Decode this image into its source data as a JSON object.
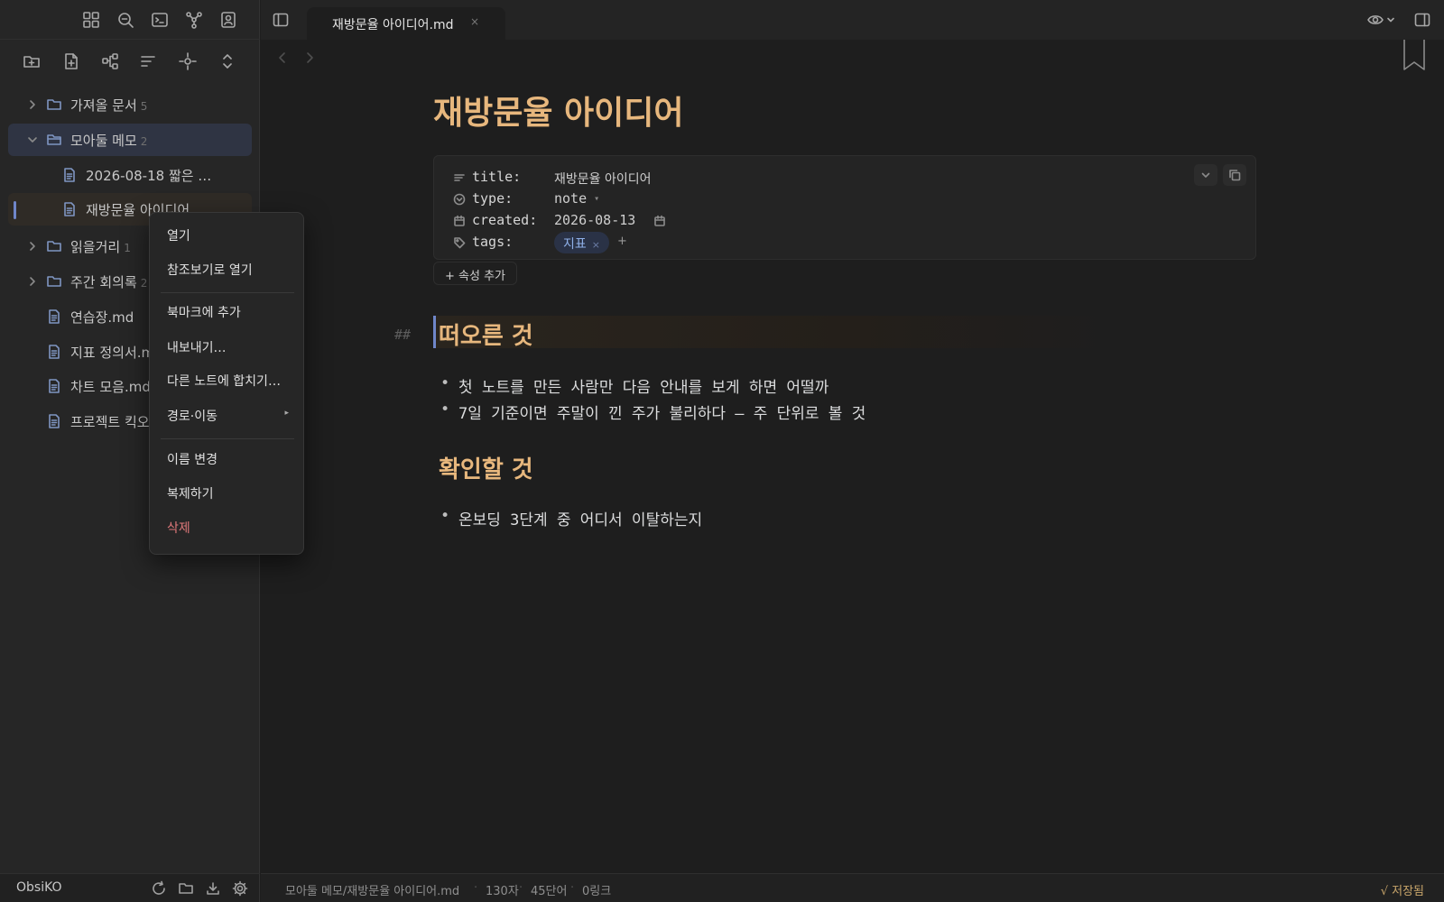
{
  "app": {
    "vault_name": "ObsiKO"
  },
  "tab": {
    "title": "재방문율 아이디어.md",
    "close": "×"
  },
  "tree": {
    "items": [
      {
        "label": "가져올 문서",
        "count": "5"
      },
      {
        "label": "모아둘 메모",
        "count": "2"
      },
      {
        "label": "2026-08-18 짧은 …"
      },
      {
        "label": "재방문율 아이디어"
      },
      {
        "label": "읽을거리",
        "count": "1"
      },
      {
        "label": "주간 회의록",
        "count": "2"
      },
      {
        "label": "연습장.md"
      },
      {
        "label": "지표 정의서.md"
      },
      {
        "label": "차트 모음.md"
      },
      {
        "label": "프로젝트 킥오프"
      }
    ]
  },
  "context_menu": {
    "items": [
      {
        "label": "열기"
      },
      {
        "label": "참조보기로 열기"
      },
      {
        "label": "북마크에 추가"
      },
      {
        "label": "내보내기…"
      },
      {
        "label": "다른 노트에 합치기…"
      },
      {
        "label": "경로·이동",
        "submenu_arrow": "▸"
      },
      {
        "label": "이름 변경"
      },
      {
        "label": "복제하기"
      },
      {
        "label": "삭제"
      }
    ]
  },
  "note": {
    "title": "재방문율 아이디어",
    "properties": {
      "title": {
        "key": "title:",
        "value": "재방문율 아이디어"
      },
      "type": {
        "key": "type:",
        "value": "note",
        "caret": "▾"
      },
      "created": {
        "key": "created:",
        "value": "2026-08-13"
      },
      "tags": {
        "key": "tags:",
        "tag": "지표",
        "tag_remove": "×",
        "add": "+"
      }
    },
    "add_property": "+ 속성 추가",
    "heading_marker": "##",
    "sections": [
      {
        "heading": "떠오른 것",
        "bullets": [
          "첫 노트를 만든 사람만 다음 안내를 보게 하면 어떨까",
          "7일 기준이면 주말이 낀 주가 불리하다 — 주 단위로 볼 것"
        ]
      },
      {
        "heading": "확인할 것",
        "bullets": [
          "온보딩 3단계 중 어디서 이탈하는지"
        ]
      }
    ]
  },
  "status": {
    "path": "모아둘 메모/재방문율 아이디어.md",
    "chars": "130자",
    "words": "45단어",
    "links": "0링크",
    "saved": "√ 저장됨"
  },
  "colors": {
    "heading": "#e7b77d",
    "accent": "#6f86c9",
    "danger": "#e0787a",
    "tag_bg": "#2a3246",
    "tag_text": "#8fb0e8"
  }
}
